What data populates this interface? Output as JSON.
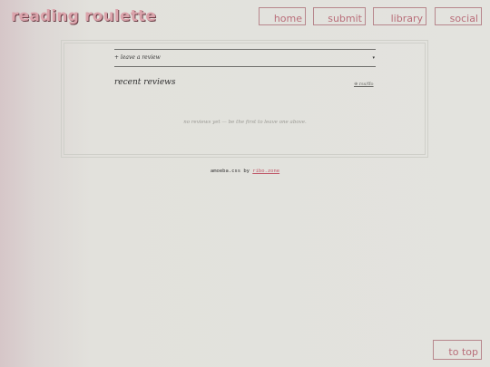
{
  "site": {
    "title": "reading roulette"
  },
  "nav": {
    "home": "home",
    "submit": "submit",
    "library": "library",
    "social": "social"
  },
  "reviews": {
    "dropdown_label": "+ leave a review",
    "dropdown_arrow": "▾",
    "section_title": "recent reviews",
    "rss_label": "⊕ rss/ffo",
    "empty_message": "no reviews yet — be the first to leave one above."
  },
  "footer": {
    "prefix": "amoeba.css by",
    "link": "ribo.zone"
  },
  "back_to_top": "to top",
  "colors": {
    "accent": "#dba3ab",
    "border": "#b7868c",
    "link": "#c0596a"
  }
}
